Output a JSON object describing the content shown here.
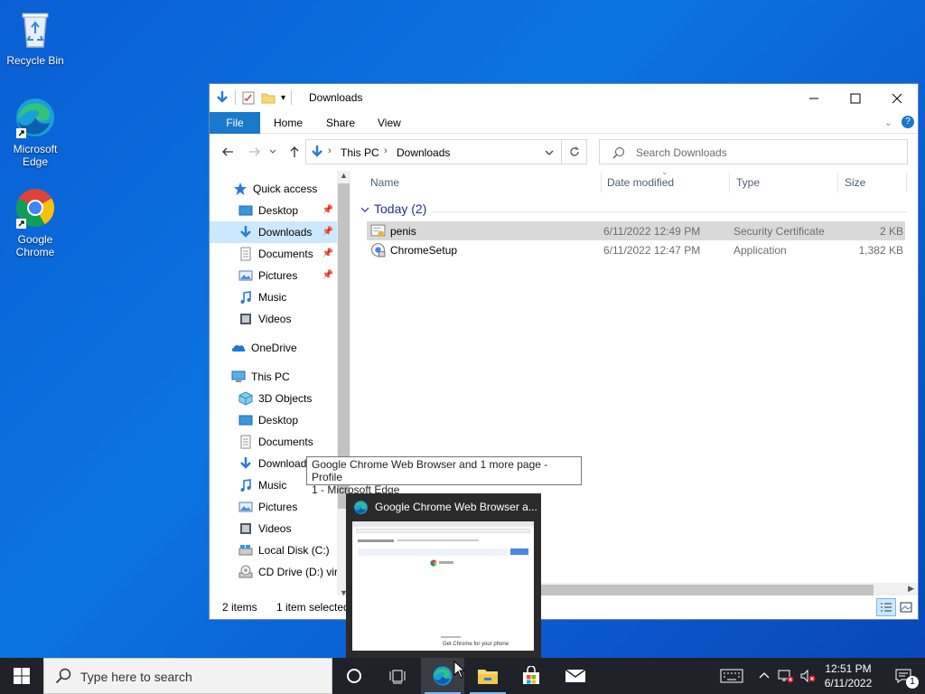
{
  "desktop": {
    "icons": [
      {
        "label": "Recycle Bin"
      },
      {
        "label": "Microsoft Edge"
      },
      {
        "label": "Google Chrome"
      }
    ]
  },
  "window": {
    "title": "Downloads",
    "ribbon_tabs": [
      "File",
      "Home",
      "Share",
      "View"
    ],
    "address": {
      "crumbs": [
        "This PC",
        "Downloads"
      ]
    },
    "search_placeholder": "Search Downloads",
    "nav": {
      "quick_access": "Quick access",
      "quick_items": [
        "Desktop",
        "Downloads",
        "Documents",
        "Pictures",
        "Music",
        "Videos"
      ],
      "onedrive": "OneDrive",
      "this_pc": "This PC",
      "pc_items": [
        "3D Objects",
        "Desktop",
        "Documents",
        "Downloads",
        "Music",
        "Pictures",
        "Videos",
        "Local Disk (C:)",
        "CD Drive (D:) virt"
      ]
    },
    "columns": [
      "Name",
      "Date modified",
      "Type",
      "Size"
    ],
    "group_label": "Today (2)",
    "files": [
      {
        "name": "penis",
        "date": "6/11/2022 12:49 PM",
        "type": "Security Certificate",
        "size": "2 KB"
      },
      {
        "name": "ChromeSetup",
        "date": "6/11/2022 12:47 PM",
        "type": "Application",
        "size": "1,382 KB"
      }
    ],
    "status": {
      "count": "2 items",
      "selected": "1 item selected"
    }
  },
  "tooltip": {
    "line1": "Google Chrome Web Browser and 1 more page - Profile",
    "line2": "1 - Microsoft Edge"
  },
  "thumbnail": {
    "title": "Google Chrome Web Browser a...",
    "page_text": "Get Chrome for your phone"
  },
  "taskbar": {
    "search_placeholder": "Type here to search",
    "time": "12:51 PM",
    "date": "6/11/2022",
    "notification_count": "1"
  },
  "colors": {
    "accent": "#1979ca",
    "taskbar": "#1f2228",
    "desktop": "#0b6fe0"
  }
}
